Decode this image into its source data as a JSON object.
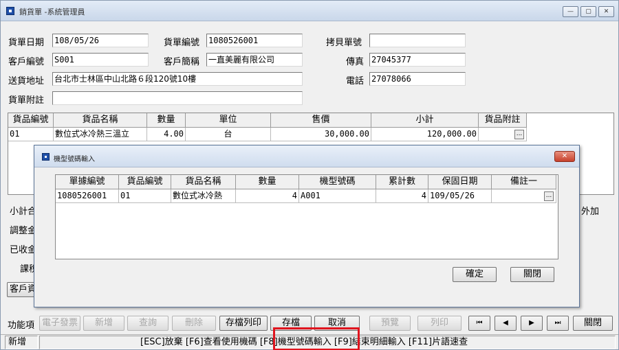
{
  "window": {
    "title": "銷貨單 -系統管理員",
    "min": "—",
    "max": "▢",
    "close": "✕"
  },
  "header": {
    "date_label": "貨單日期",
    "date_value": "108/05/26",
    "no_label": "貨單編號",
    "no_value": "1080526001",
    "copy_label": "拷貝單號",
    "copy_value": "",
    "cust_label": "客戶編號",
    "cust_value": "S001",
    "short_label": "客戶簡稱",
    "short_value": "一直美麗有限公司",
    "fax_label": "傳真",
    "fax_value": "27045377",
    "addr_label": "送貨地址",
    "addr_value": "台北市士林區中山北路６段120號10樓",
    "tel_label": "電話",
    "tel_value": "27078066",
    "note_label": "貨單附註",
    "note_value": ""
  },
  "detail": {
    "headers": [
      "貨品編號",
      "貨品名稱",
      "數量",
      "單位",
      "售價",
      "小計",
      "貨品附註"
    ],
    "row": {
      "code": "01",
      "name": "數位式冰冷熱三溫立",
      "qty": "4.00",
      "unit": "台",
      "price": "30,000.00",
      "subtotal": "120,000.00",
      "note": "",
      "more": "..."
    }
  },
  "partial_labels": {
    "subtotal": "小計合",
    "adjust": "調整金",
    "received": "已收金",
    "tax": "課稅",
    "customer": "客戶資",
    "extra": "外加"
  },
  "dialog": {
    "title": "機型號碼輸入",
    "close": "✕",
    "headers": [
      "單據編號",
      "貨品編號",
      "貨品名稱",
      "數量",
      "機型號碼",
      "累計數",
      "保固日期",
      "備註一"
    ],
    "row": {
      "doc_no": "1080526001",
      "item_code": "01",
      "item_name": "數位式冰冷熱",
      "qty": "4",
      "model_no": "A001",
      "cumulative": "4",
      "warranty": "109/05/26",
      "remark": "",
      "more": "..."
    },
    "ok": "確定",
    "close_button": "關閉"
  },
  "toolbar": {
    "label": "功能項",
    "e_invoice": "電子發票",
    "add": "新增",
    "query": "查詢",
    "delete": "刪除",
    "save_print": "存檔列印",
    "save": "存檔",
    "cancel": "取消",
    "preview": "預覽",
    "print": "列印",
    "first": "⏮",
    "prev": "◀",
    "next": "▶",
    "last": "⏭",
    "close": "關閉"
  },
  "status": {
    "mode": "新增",
    "hint_before": "[ESC]放棄 [F6]查看使用機碼",
    "hint_highlight": "[F8]機型號碼輸入",
    "hint_after": "[F9]結束明細輸入 [F11]片語速查"
  },
  "colors": {
    "highlight": "#e0141e",
    "close_red": "#c7412c",
    "accent": "#1e4fa8"
  }
}
